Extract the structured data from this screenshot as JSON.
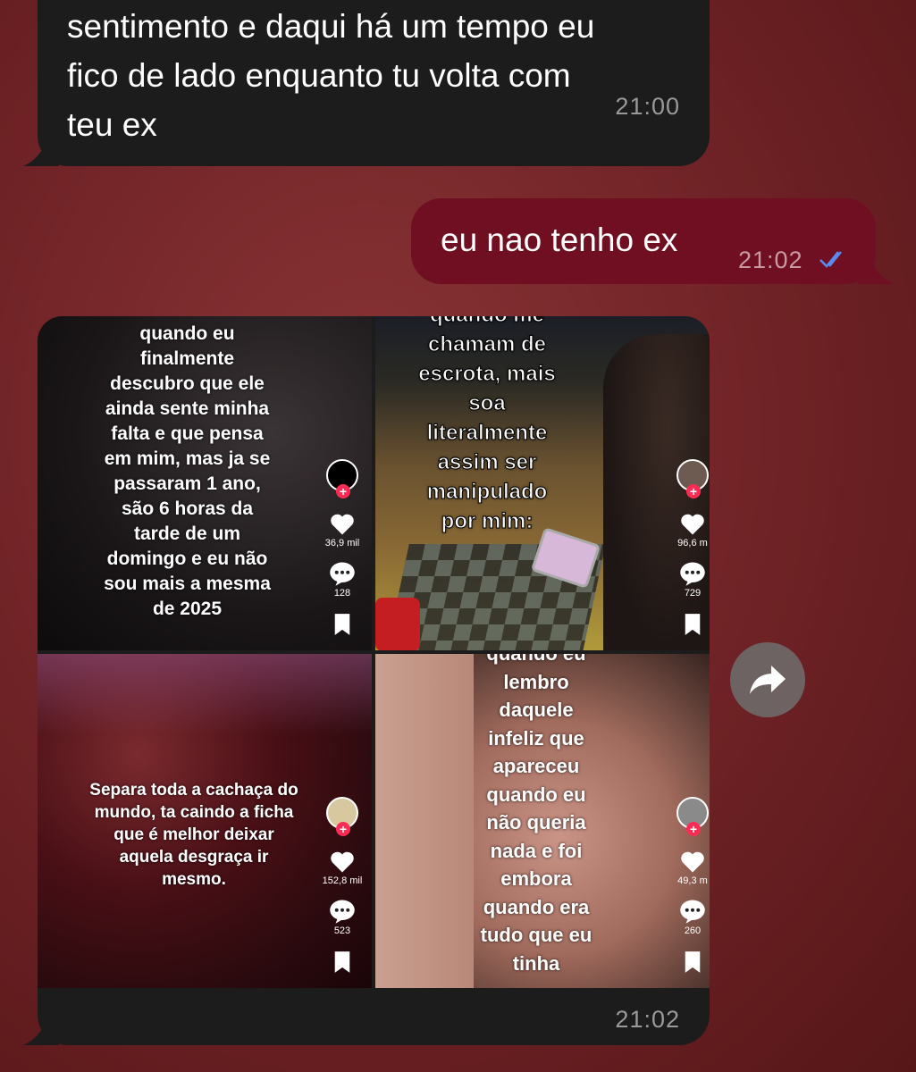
{
  "messages": {
    "incoming_1": {
      "lines": [
        "sentimento e daqui há um tempo eu",
        "fico de lado enquanto tu volta com",
        "teu ex"
      ],
      "time": "21:00"
    },
    "outgoing_1": {
      "text": "eu nao tenho ex",
      "time": "21:02",
      "status_icon": "double-check-icon"
    },
    "incoming_2": {
      "time": "21:02"
    }
  },
  "tiktok_grid": [
    {
      "caption_lines": [
        "quando eu",
        "finalmente",
        "descubro que ele",
        "ainda sente minha",
        "falta e que pensa",
        "em mim, mas ja se",
        "passaram 1 ano,",
        "são 6 horas da",
        "tarde de um",
        "domingo e eu não",
        "sou mais a mesma",
        "de 2025"
      ],
      "likes": "36,9 mil",
      "comments": "128"
    },
    {
      "caption_lines": [
        "quando me",
        "chamam de",
        "escrota, mais",
        "soa",
        "literalmente",
        "assim ser",
        "manipulado",
        "por mim:"
      ],
      "likes": "96,6 m",
      "comments": "729"
    },
    {
      "caption_lines": [
        "Separa toda a cachaça do",
        "mundo, ta caindo a ficha",
        "que é melhor deixar",
        "aquela desgraça ir",
        "mesmo."
      ],
      "likes": "152,8 mil",
      "comments": "523"
    },
    {
      "caption_lines": [
        "quando eu",
        "lembro",
        "daquele",
        "infeliz que",
        "apareceu",
        "quando eu",
        "não queria",
        "nada e foi",
        "embora",
        "quando era",
        "tudo que eu",
        "tinha"
      ],
      "likes": "49,3 m",
      "comments": "260"
    }
  ],
  "colors": {
    "incoming_bubble": "#1c1c1d",
    "outgoing_bubble": "#6f0f21",
    "check_blue": "#5b8cf0",
    "tiktok_red": "#fe2c55"
  },
  "share_button": {
    "icon": "share-arrow-icon"
  }
}
